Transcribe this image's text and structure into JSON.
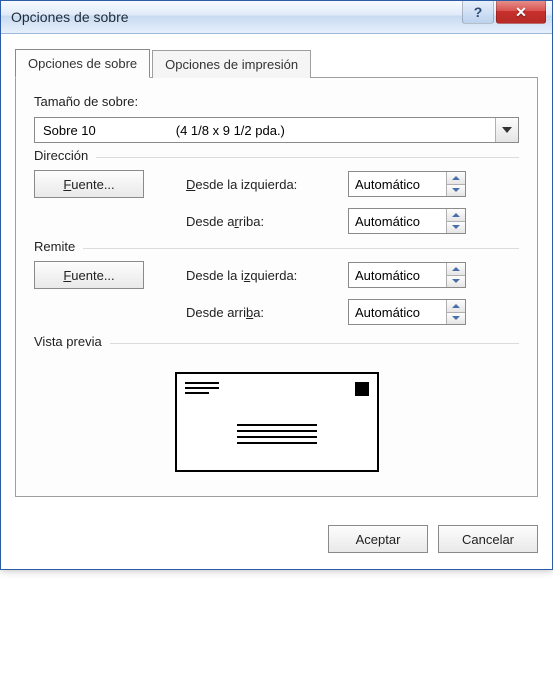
{
  "window": {
    "title": "Opciones de sobre",
    "help_icon": "help-icon",
    "close_icon": "close-icon"
  },
  "tabs": {
    "envelope": "Opciones de sobre",
    "print": "Opciones de impresión"
  },
  "size": {
    "label": "Tamaño de sobre:",
    "value_name": "Sobre 10",
    "value_dim": "(4 1/8 x 9 1/2 pda.)"
  },
  "address": {
    "legend": "Dirección",
    "font_btn_pre": "F",
    "font_btn_post": "uente...",
    "from_left_pre": "D",
    "from_left_post": "esde la izquierda:",
    "from_top_pre": "Desde a",
    "from_top_mid": "r",
    "from_top_post": "riba:",
    "left_value": "Automático",
    "top_value": "Automático"
  },
  "return": {
    "legend": "Remite",
    "font_btn_pre": "F",
    "font_btn_post": "uente...",
    "from_left_pre": "Desde la i",
    "from_left_mid": "z",
    "from_left_post": "quierda:",
    "from_top_pre": "Desde arri",
    "from_top_mid": "b",
    "from_top_post": "a:",
    "left_value": "Automático",
    "top_value": "Automático"
  },
  "preview": {
    "legend": "Vista previa"
  },
  "buttons": {
    "ok": "Aceptar",
    "cancel": "Cancelar"
  }
}
